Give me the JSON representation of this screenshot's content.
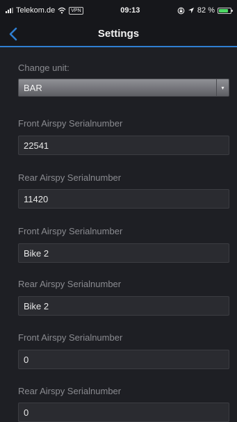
{
  "status_bar": {
    "carrier": "Telekom.de",
    "vpn": "VPN",
    "time": "09:13",
    "battery": "82 %",
    "battery_level": 0.82
  },
  "nav": {
    "title": "Settings"
  },
  "settings": {
    "unit_label": "Change unit:",
    "unit_value": "BAR",
    "fields": [
      {
        "label": "Front Airspy Serialnumber",
        "value": "22541"
      },
      {
        "label": "Rear Airspy Serialnumber",
        "value": "11420"
      },
      {
        "label": "Front Airspy Serialnumber",
        "value": "Bike 2"
      },
      {
        "label": "Rear Airspy Serialnumber",
        "value": "Bike 2"
      },
      {
        "label": "Front Airspy Serialnumber",
        "value": "0"
      },
      {
        "label": "Rear Airspy Serialnumber",
        "value": "0"
      }
    ]
  },
  "colors": {
    "accent": "#2f7fd1",
    "background": "#1e1f24",
    "battery": "#4cd964"
  }
}
